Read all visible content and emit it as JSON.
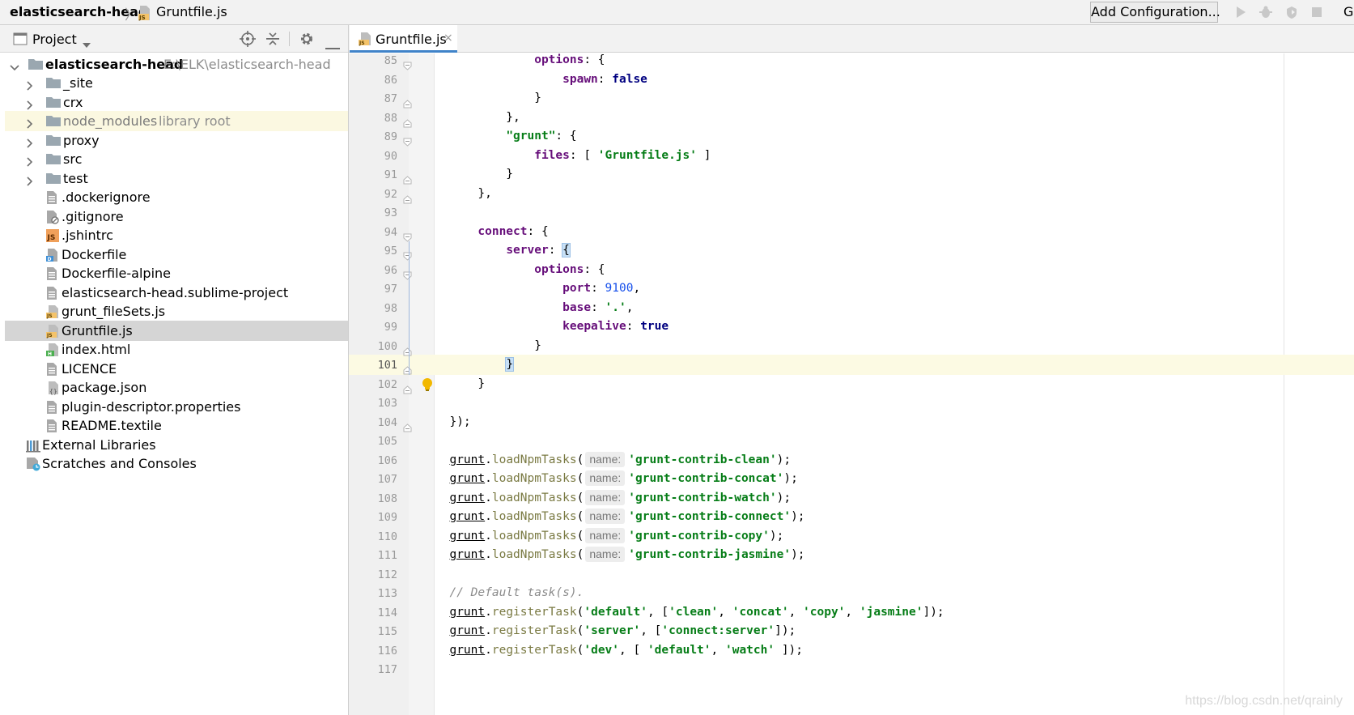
{
  "topbar": {
    "breadcrumb_root": "elasticsearch-head",
    "breadcrumb_separator": "〉",
    "breadcrumb_file": "Gruntfile.js",
    "add_configuration": "Add Configuration...",
    "cut_text": "G",
    "icons": [
      "run-icon",
      "debug-icon",
      "coverage-icon",
      "stop-icon"
    ]
  },
  "project_panel": {
    "title": "Project",
    "header_icons": [
      "locate-icon",
      "collapse-all-icon",
      "gear-icon",
      "hide-icon"
    ],
    "root_name": "elasticsearch-head",
    "root_path": "E:\\ELK\\elasticsearch-head",
    "folders": [
      "_site",
      "crx",
      "node_modules",
      "proxy",
      "src",
      "test"
    ],
    "library_root_label": "library root",
    "files": [
      ".dockerignore",
      ".gitignore",
      ".jshintrc",
      "Dockerfile",
      "Dockerfile-alpine",
      "elasticsearch-head.sublime-project",
      "grunt_fileSets.js",
      "Gruntfile.js",
      "index.html",
      "LICENCE",
      "package.json",
      "plugin-descriptor.properties",
      "README.textile"
    ],
    "external_libraries": "External Libraries",
    "scratches": "Scratches and Consoles",
    "selected_file": "Gruntfile.js"
  },
  "editor": {
    "tab_label": "Gruntfile.js",
    "tab_close": "×",
    "line_numbers": [
      "85",
      "86",
      "87",
      "88",
      "89",
      "90",
      "91",
      "92",
      "93",
      "94",
      "95",
      "96",
      "97",
      "98",
      "99",
      "100",
      "101",
      "102",
      "103",
      "104",
      "105",
      "106",
      "107",
      "108",
      "109",
      "110",
      "111",
      "112",
      "113",
      "114",
      "115",
      "116",
      "117"
    ],
    "current_line": "101",
    "code": {
      "options": "options",
      "spawn": "spawn",
      "false": "false",
      "grunt_key": "\"grunt\"",
      "files": "files",
      "gruntfile_str": "'Gruntfile.js'",
      "connect": "connect",
      "server": "server",
      "port": "port",
      "port_value": "9100",
      "base": "base",
      "base_value": "'.'",
      "keepalive": "keepalive",
      "true": "true",
      "grunt_obj": "grunt",
      "load_fn": "loadNpmTasks",
      "register_fn": "registerTask",
      "name_hint": "name:",
      "tasks": [
        "'grunt-contrib-clean'",
        "'grunt-contrib-concat'",
        "'grunt-contrib-watch'",
        "'grunt-contrib-connect'",
        "'grunt-contrib-copy'",
        "'grunt-contrib-jasmine'"
      ],
      "comment": "// Default task(s).",
      "reg_default": "'default'",
      "reg_default_list": [
        "'clean'",
        "'concat'",
        "'copy'",
        "'jasmine'"
      ],
      "reg_server": "'server'",
      "reg_server_list": "'connect:server'",
      "reg_dev": "'dev'",
      "reg_dev_list": [
        "'default'",
        "'watch'"
      ]
    }
  },
  "watermark": "https://blog.csdn.net/qrainly"
}
